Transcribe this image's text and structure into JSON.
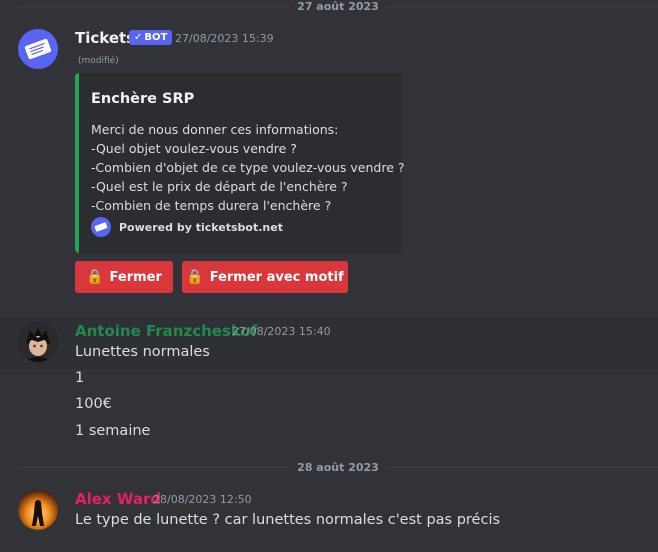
{
  "dividers": [
    "27 août 2023",
    "28 août 2023"
  ],
  "bot_message": {
    "username": "Tickets",
    "username_color": "#f2f3f5",
    "badge": "BOT",
    "timestamp": "27/08/2023 15:39",
    "edited": "(modifié)",
    "embed": {
      "accent_color": "#23a559",
      "title": "Enchère SRP",
      "description": [
        "Merci de nous donner ces informations:",
        "-Quel objet voulez-vous vendre ?",
        "-Combien d'objet de ce type voulez-vous vendre ?",
        "-Quel est le prix de départ de l'enchère ?",
        "-Combien de temps durera l'enchère ?"
      ],
      "footer": "Powered by ticketsbot.net"
    },
    "buttons": [
      {
        "label": "Fermer",
        "icon": "lock-icon"
      },
      {
        "label": "Fermer avec motif",
        "icon": "lock-icon"
      }
    ]
  },
  "user_message_1": {
    "username": "Antoine Franzcheskof",
    "username_color": "#1f8b4c",
    "timestamp": "27/08/2023 15:40",
    "lines": [
      "Lunettes normales",
      "1",
      "100€",
      "1 semaine"
    ]
  },
  "user_message_2": {
    "username": "Alex Ward",
    "username_color": "#e91e63",
    "timestamp": "28/08/2023 12:50",
    "lines": [
      "Le type de lunette ? car lunettes normales c'est pas précis"
    ]
  },
  "colors": {
    "background": "#313338",
    "button_danger": "#da373c",
    "bot_badge": "#5865f2"
  }
}
